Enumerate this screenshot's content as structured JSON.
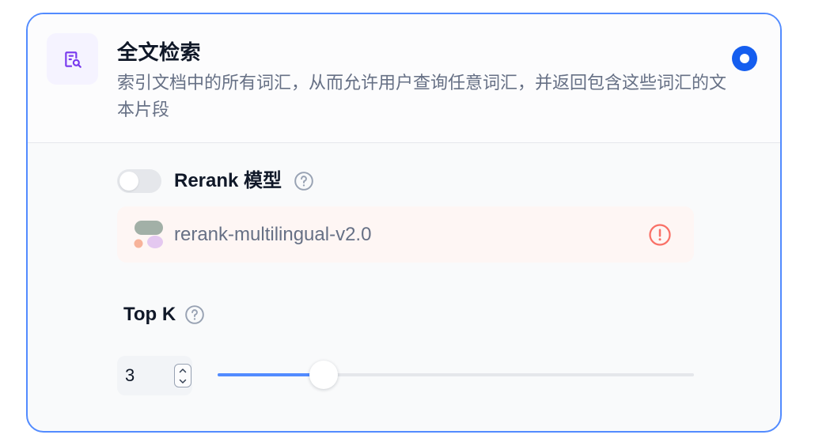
{
  "retrieval_option": {
    "title": "全文检索",
    "description": "索引文档中的所有词汇，从而允许用户查询任意词汇，并返回包含这些词汇的文本片段",
    "icon": "full-text-search-icon",
    "selected": true
  },
  "rerank": {
    "enabled": false,
    "label": "Rerank 模型",
    "model_name": "rerank-multilingual-v2.0",
    "status": "warning"
  },
  "top_k": {
    "label": "Top K",
    "value": "3",
    "min": 1,
    "max": 10
  },
  "colors": {
    "accent": "#528BFF",
    "radio": "#155EEF",
    "icon_purple": "#7839EE",
    "warning": "#F97066"
  }
}
